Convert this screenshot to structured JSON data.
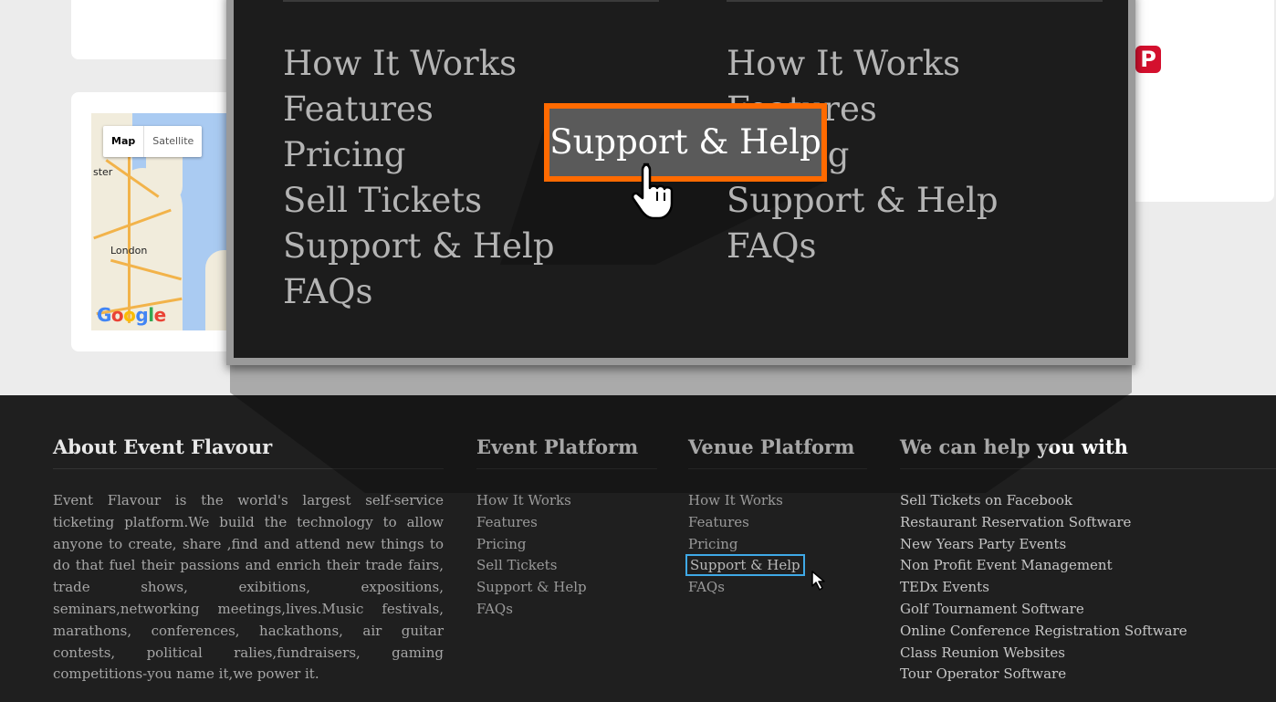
{
  "social": {
    "pinterest_glyph": "P"
  },
  "map": {
    "tabs": [
      "Map",
      "Satellite"
    ],
    "labels": {
      "london": "London",
      "ster": "ster"
    },
    "google_logo": [
      "G",
      "o",
      "o",
      "g",
      "l",
      "e"
    ]
  },
  "zoom": {
    "event_links": [
      "How It Works",
      "Features",
      "Pricing",
      "Sell Tickets",
      "Support & Help",
      "FAQs"
    ],
    "venue_links": [
      "How It Works",
      "Features",
      "Pricing",
      "Support & Help",
      "FAQs"
    ],
    "highlight_label": "Support & Help",
    "accent_color": "#ff6a00"
  },
  "footer": {
    "about": {
      "title": "About Event Flavour",
      "text": "Event Flavour is the world's largest self-service ticketing platform.We build the technology to allow anyone to create, share ,find and attend new things to do that fuel their passions and enrich their trade fairs, trade shows, exibitions, expositions, seminars,networking meetings,lives.Music festivals, marathons, conferences, hackathons, air guitar contests, political ralies,fundraisers, gaming competitions-you name it,we power it."
    },
    "event_platform": {
      "title": "Event Platform",
      "links": [
        "How It Works",
        "Features",
        "Pricing",
        "Sell Tickets",
        "Support & Help",
        "FAQs"
      ]
    },
    "venue_platform": {
      "title": "Venue Platform",
      "links": [
        "How It Works",
        "Features",
        "Pricing",
        "Support & Help",
        "FAQs"
      ],
      "highlight_color": "#3fa9e6"
    },
    "help": {
      "title_plain": "We can help ",
      "title_bold": "you with",
      "links": [
        "Sell Tickets on Facebook",
        "Restaurant Reservation Software",
        "New Years Party Events",
        "Non Profit Event Management",
        "TEDx Events",
        "Golf Tournament Software",
        "Online Conference Registration Software",
        "Class Reunion Websites",
        "Tour Operator Software"
      ]
    }
  }
}
